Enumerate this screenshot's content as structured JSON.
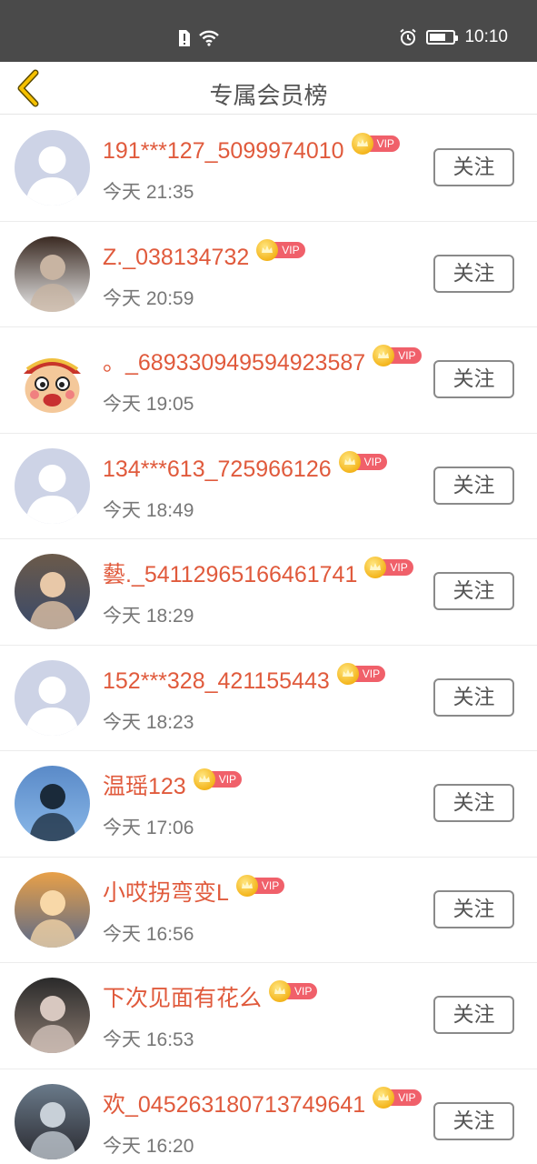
{
  "status_bar": {
    "time": "10:10",
    "icons": [
      "sim-alert-icon",
      "wifi-icon",
      "alarm-icon",
      "battery-icon"
    ],
    "battery_level_percent": 70
  },
  "header": {
    "title": "专属会员榜",
    "back_icon": "chevron-left-icon",
    "accent_color": "#f5c000"
  },
  "members": [
    {
      "name": "191***127_5099974010",
      "time": "今天 21:35",
      "badge": "VIP",
      "follow_label": "关注",
      "avatar": "default"
    },
    {
      "name": "Z._038134732",
      "time": "今天 20:59",
      "badge": "VIP",
      "follow_label": "关注",
      "avatar": "photo"
    },
    {
      "name": "。_68933094959492358​7",
      "time": "今天 19:05",
      "badge": "VIP",
      "follow_label": "关注",
      "avatar": "cartoon"
    },
    {
      "name": "134***613_725966126",
      "time": "今天 18:49",
      "badge": "VIP",
      "follow_label": "关注",
      "avatar": "default"
    },
    {
      "name": "藝._54112965166461741",
      "time": "今天 18:29",
      "badge": "VIP",
      "follow_label": "关注",
      "avatar": "photo"
    },
    {
      "name": "152***328_421155443",
      "time": "今天 18:23",
      "badge": "VIP",
      "follow_label": "关注",
      "avatar": "default"
    },
    {
      "name": "温瑶123",
      "time": "今天 17:06",
      "badge": "VIP",
      "follow_label": "关注",
      "avatar": "photo"
    },
    {
      "name": "小哎拐弯变L",
      "time": "今天 16:56",
      "badge": "VIP",
      "follow_label": "关注",
      "avatar": "photo"
    },
    {
      "name": "下次见面有花么",
      "time": "今天 16:53",
      "badge": "VIP",
      "follow_label": "关注",
      "avatar": "photo"
    },
    {
      "name": "欢_045263180713749641",
      "time": "今天 16:20",
      "badge": "VIP",
      "follow_label": "关注",
      "avatar": "photo"
    }
  ],
  "colors": {
    "name_color": "#e05a3c",
    "vip_tag": "#f0606a",
    "status_bar_bg": "#4a4a4a"
  }
}
